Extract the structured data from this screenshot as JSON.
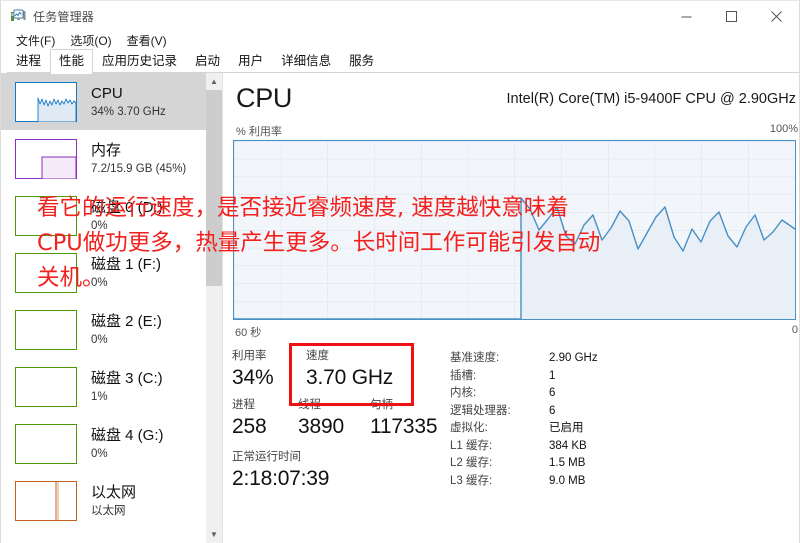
{
  "window": {
    "title": "任务管理器",
    "icon": "task-manager-icon",
    "minimize_label": "—",
    "maximize_label": "□",
    "close_label": "✕"
  },
  "menu": {
    "items": [
      {
        "label": "文件(F)"
      },
      {
        "label": "选项(O)"
      },
      {
        "label": "查看(V)"
      }
    ]
  },
  "tabs": {
    "active": "性能",
    "items": [
      {
        "label": "进程"
      },
      {
        "label": "性能"
      },
      {
        "label": "应用历史记录"
      },
      {
        "label": "启动"
      },
      {
        "label": "用户"
      },
      {
        "label": "详细信息"
      },
      {
        "label": "服务"
      }
    ]
  },
  "sidebar": {
    "items": [
      {
        "name": "CPU",
        "sub": "34% 3.70 GHz",
        "color": "#0f72b5",
        "type": "cpu",
        "selected": true
      },
      {
        "name": "内存",
        "sub": "7.2/15.9 GB (45%)",
        "color": "#8c2fbf",
        "type": "memory",
        "selected": false
      },
      {
        "name": "磁盘 0 (D:)",
        "sub": "0%",
        "color": "#4e9a06",
        "type": "disk",
        "selected": false
      },
      {
        "name": "磁盘 1 (F:)",
        "sub": "0%",
        "color": "#4e9a06",
        "type": "disk",
        "selected": false
      },
      {
        "name": "磁盘 2 (E:)",
        "sub": "0%",
        "color": "#4e9a06",
        "type": "disk",
        "selected": false
      },
      {
        "name": "磁盘 3 (C:)",
        "sub": "1%",
        "color": "#4e9a06",
        "type": "disk",
        "selected": false
      },
      {
        "name": "磁盘 4 (G:)",
        "sub": "0%",
        "color": "#4e9a06",
        "type": "disk",
        "selected": false
      },
      {
        "name": "以太网",
        "sub": "以太网",
        "color": "#c2601f",
        "type": "ethernet",
        "selected": false
      }
    ]
  },
  "cpu": {
    "title": "CPU",
    "model": "Intel(R) Core(TM) i5-9400F CPU @ 2.90GHz",
    "chart_caption": "% 利用率",
    "chart_max": "100%",
    "chart_time_left": "60 秒",
    "chart_time_right": "0",
    "stats": {
      "utilization_label": "利用率",
      "utilization_value": "34%",
      "speed_label": "速度",
      "speed_value": "3.70 GHz",
      "processes_label": "进程",
      "processes_value": "258",
      "threads_label": "线程",
      "threads_value": "3890",
      "handles_label": "句柄",
      "handles_value": "117335",
      "uptime_label": "正常运行时间",
      "uptime_value": "2:18:07:39"
    },
    "specs": [
      {
        "key": "基准速度:",
        "value": "2.90 GHz"
      },
      {
        "key": "插槽:",
        "value": "1"
      },
      {
        "key": "内核:",
        "value": "6"
      },
      {
        "key": "逻辑处理器:",
        "value": "6"
      },
      {
        "key": "虚拟化:",
        "value": "已启用"
      },
      {
        "key": "L1 缓存:",
        "value": "384 KB"
      },
      {
        "key": "L2 缓存:",
        "value": "1.5 MB"
      },
      {
        "key": "L3 缓存:",
        "value": "9.0 MB"
      }
    ]
  },
  "annotation": {
    "text": "看它的运行速度，是否接近睿频速度, 速度越快意味着\nCPU做功更多，热量产生更多。长时间工作可能引发自动\n关机。",
    "color": "#f3211e"
  },
  "highlight": {
    "color": "#ee1111"
  },
  "chart_data": {
    "type": "area",
    "title": "% 利用率",
    "xlabel": "",
    "ylabel": "% 利用率",
    "ylim": [
      0,
      100
    ],
    "xlim": [
      60,
      0
    ],
    "grid": true,
    "line_color": "#4a8fc4",
    "fill_color": "#e8eff7",
    "x_tick_labels": [
      "60 秒",
      "0"
    ],
    "y_tick_labels": [
      "100%"
    ],
    "series": [
      {
        "name": "CPU 利用率",
        "x": [
          60,
          59,
          58,
          57,
          56,
          55,
          54,
          53,
          52,
          51,
          50,
          49,
          48,
          47,
          46,
          45,
          44,
          43,
          42,
          41,
          40,
          39,
          38,
          37,
          36,
          35,
          34,
          33,
          32,
          31,
          30,
          29,
          28,
          27,
          26,
          25,
          24,
          23,
          22,
          21,
          20,
          19,
          18,
          17,
          16,
          15,
          14,
          13,
          12,
          11,
          10,
          9,
          8,
          7,
          6,
          5,
          4,
          3,
          2,
          1,
          0
        ],
        "values": [
          0,
          0,
          0,
          0,
          0,
          0,
          0,
          0,
          0,
          0,
          0,
          0,
          0,
          0,
          0,
          0,
          0,
          0,
          0,
          0,
          0,
          0,
          0,
          0,
          0,
          0,
          0,
          0,
          0,
          0,
          0,
          0,
          68,
          62,
          50,
          58,
          66,
          46,
          42,
          52,
          40,
          56,
          62,
          34,
          46,
          58,
          30,
          52,
          44,
          62,
          36,
          40,
          30,
          34,
          52,
          62,
          42,
          50,
          46,
          38,
          52
        ]
      }
    ]
  }
}
